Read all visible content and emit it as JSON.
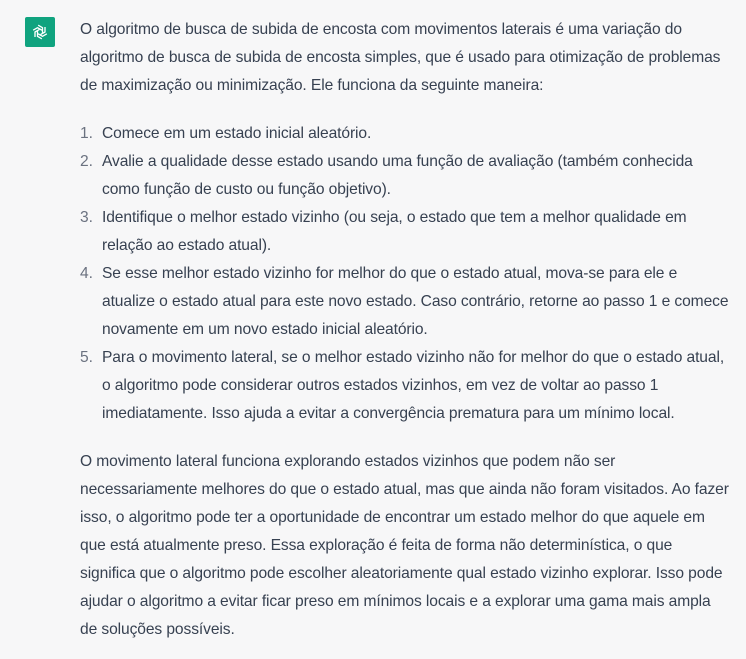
{
  "assistant": {
    "avatar_icon": "openai-logo-icon",
    "avatar_color": "#10a37f"
  },
  "response": {
    "intro": "O algoritmo de busca de subida de encosta com movimentos laterais é uma variação do algoritmo de busca de subida de encosta simples, que é usado para otimização de problemas de maximização ou minimização. Ele funciona da seguinte maneira:",
    "steps": [
      {
        "num": "1.",
        "text": "Comece em um estado inicial aleatório."
      },
      {
        "num": "2.",
        "text": "Avalie a qualidade desse estado usando uma função de avaliação (também conhecida como função de custo ou função objetivo)."
      },
      {
        "num": "3.",
        "text": "Identifique o melhor estado vizinho (ou seja, o estado que tem a melhor qualidade em relação ao estado atual)."
      },
      {
        "num": "4.",
        "text": "Se esse melhor estado vizinho for melhor do que o estado atual, mova-se para ele e atualize o estado atual para este novo estado. Caso contrário, retorne ao passo 1 e comece novamente em um novo estado inicial aleatório."
      },
      {
        "num": "5.",
        "text": "Para o movimento lateral, se o melhor estado vizinho não for melhor do que o estado atual, o algoritmo pode considerar outros estados vizinhos, em vez de voltar ao passo 1 imediatamente. Isso ajuda a evitar a convergência prematura para um mínimo local."
      }
    ],
    "conclusion": "O movimento lateral funciona explorando estados vizinhos que podem não ser necessariamente melhores do que o estado atual, mas que ainda não foram visitados. Ao fazer isso, o algoritmo pode ter a oportunidade de encontrar um estado melhor do que aquele em que está atualmente preso. Essa exploração é feita de forma não determinística, o que significa que o algoritmo pode escolher aleatoriamente qual estado vizinho explorar. Isso pode ajudar o algoritmo a evitar ficar preso em mínimos locais e a explorar uma gama mais ampla de soluções possíveis."
  }
}
